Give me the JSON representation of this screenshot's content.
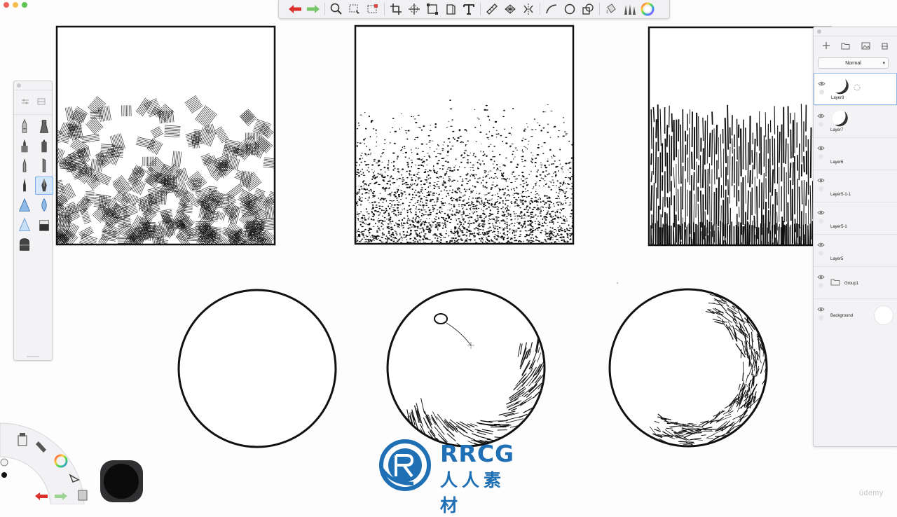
{
  "window": {
    "traffic_lights": [
      "close",
      "minimize",
      "zoom"
    ]
  },
  "toolbar": {
    "icons": [
      "undo-icon",
      "redo-icon",
      "zoom-icon",
      "lasso-select-icon",
      "marquee-select-icon",
      "crop-icon",
      "transform-icon",
      "distort-icon",
      "perspective-icon",
      "text-icon",
      "ruler-icon",
      "perspective-guide-icon",
      "symmetry-icon",
      "curve-icon",
      "ellipse-icon",
      "shape-icon",
      "fill-icon",
      "brush-library-icon",
      "color-wheel-icon"
    ],
    "accent_undo": "#d9302a",
    "accent_redo": "#78c66a"
  },
  "layers": {
    "blend_mode": "Normal",
    "items": [
      {
        "name": "Layer8",
        "selected": true,
        "thumb": "crescent"
      },
      {
        "name": "Layer7",
        "selected": false,
        "thumb": "crescent"
      },
      {
        "name": "Layer6",
        "selected": false,
        "thumb": "empty"
      },
      {
        "name": "Layer5-1-1",
        "selected": false,
        "thumb": "empty"
      },
      {
        "name": "Layer5-1",
        "selected": false,
        "thumb": "empty"
      },
      {
        "name": "Layer5",
        "selected": false,
        "thumb": "empty"
      },
      {
        "name": "Group1",
        "selected": false,
        "thumb": "folder"
      },
      {
        "name": "Background",
        "selected": false,
        "thumb": "white"
      }
    ]
  },
  "brushes": {
    "selected_index": 7,
    "items": [
      "pencil",
      "marker",
      "ballpoint",
      "felt-tip",
      "pencil-fine",
      "chisel",
      "ink-pen",
      "fountain-pen",
      "airbrush",
      "water-drop",
      "smudge",
      "eraser-block",
      "eraser-round"
    ]
  },
  "canvas": {
    "panels": [
      "hatching-texture",
      "stipple-texture",
      "vertical-line-texture"
    ],
    "circles": [
      "empty-circle",
      "hatched-shadow-sphere",
      "crescent-shaded-sphere"
    ]
  },
  "watermark": {
    "brand": "RRCG",
    "subtitle": "人人素材"
  },
  "footer": {
    "udemy": "ûdemy"
  }
}
